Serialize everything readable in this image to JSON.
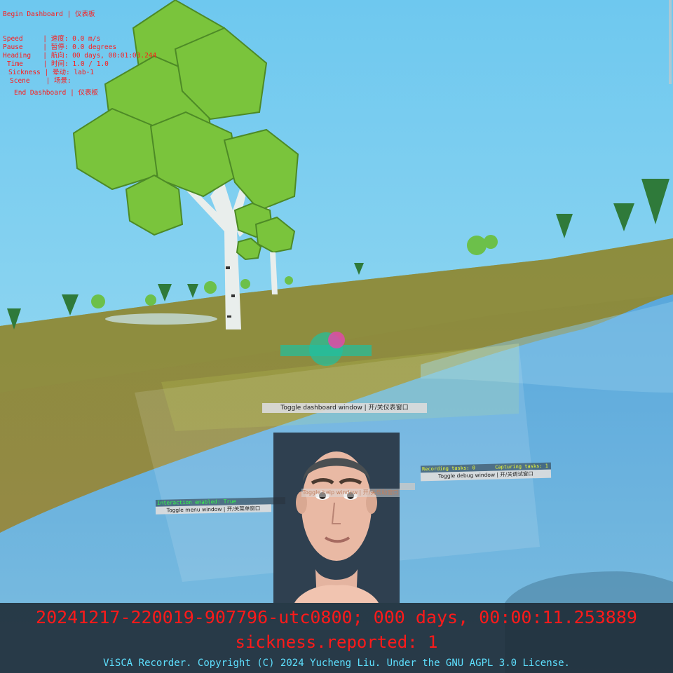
{
  "dashboard": {
    "header": "Begin Dashboard | 仪表板",
    "rows": [
      {
        "label": "Speed",
        "sep": "|",
        "value": "速度: 0.0 m/s"
      },
      {
        "label": "Pause",
        "sep": "|",
        "value": "暂停: 0.0 degrees"
      },
      {
        "label": "Heading",
        "sep": "|",
        "value": "航向: 00 days, 00:01:03.244"
      },
      {
        "label": "Time",
        "sep": "|",
        "value": "时间: 1.0 / 1.0"
      },
      {
        "label": "Sickness",
        "sep": "|",
        "value": "晕动: lab-1"
      },
      {
        "label": "Scene",
        "sep": "|",
        "value": "场景:"
      }
    ],
    "footer": "End Dashboard | 仪表板",
    "toggle_label": "Toggle dashboard window | 开/关仪表窗口"
  },
  "menu_window": {
    "status": "Interaction enabled: True",
    "toggle_label": "Toggle menu window | 开/关菜单窗口"
  },
  "help_window": {
    "toggle_label": "Toggle help window | 开/关帮助窗口"
  },
  "debug_window": {
    "recording_tasks": "Recording tasks: 0",
    "capturing_tasks": "Capturing tasks: 1",
    "toggle_label": "Toggle debug window | 开/关调试窗口"
  },
  "recorder": {
    "recording_id": "20241217-220019-907796-utc0800; 000 days, 00:00:11.253889",
    "sickness_reported": "sickness.reported: 1",
    "copyright": "ViSCA Recorder. Copyright (C) 2024 Yucheng Liu. Under the GNU AGPL 3.0 License."
  },
  "colors": {
    "sky": "#7fd0ee",
    "grass": "#8f8d3c",
    "water": "#6cb6e0",
    "dashboard_text": "#ff1a1a",
    "status_green": "#33ff44",
    "status_yellow": "#f2ff33",
    "copyright": "#5ee0ff"
  }
}
